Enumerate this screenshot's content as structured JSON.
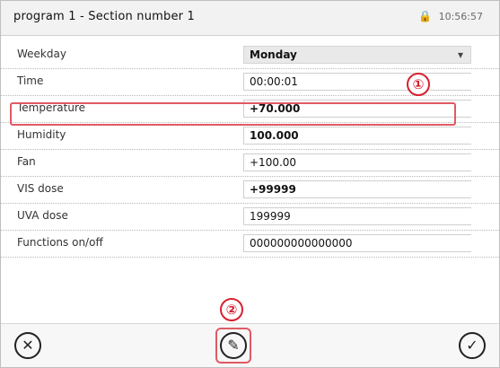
{
  "header": {
    "title": "program 1 - Section number 1",
    "status": "10:56:57",
    "status_icon": "lock-icon"
  },
  "rows": [
    {
      "label": "Weekday",
      "value": "Monday",
      "type": "select"
    },
    {
      "label": "Time",
      "value": "00:00:01"
    },
    {
      "label": "Temperature",
      "value": "+70.000",
      "bold": true
    },
    {
      "label": "Humidity",
      "value": "100.000",
      "bold": true
    },
    {
      "label": "Fan",
      "value": "+100.00"
    },
    {
      "label": "VIS dose",
      "value": "+99999",
      "bold": true
    },
    {
      "label": "UVA dose",
      "value": "199999"
    },
    {
      "label": "Functions on/off",
      "value": "000000000000000"
    }
  ],
  "annotations": {
    "marker1": "①",
    "marker2": "②",
    "highlight_color": "#e05a63"
  },
  "bottombar": {
    "cancel_icon": "close-circle-icon",
    "edit_icon": "edit-pencil-icon",
    "confirm_icon": "check-circle-icon"
  }
}
